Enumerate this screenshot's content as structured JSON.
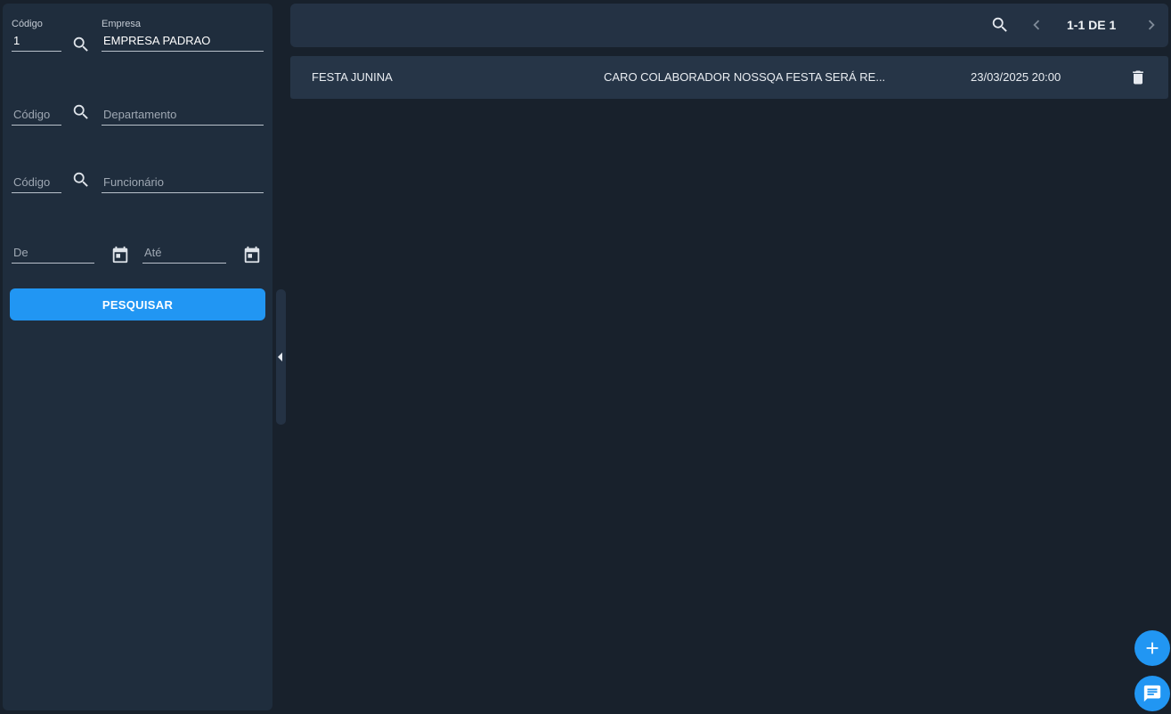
{
  "filters": {
    "empresa_code": {
      "label": "Código",
      "value": "1",
      "placeholder": ""
    },
    "empresa_name": {
      "label": "Empresa",
      "value": "EMPRESA PADRAO",
      "placeholder": ""
    },
    "departamento_code": {
      "placeholder": "Código"
    },
    "departamento_name": {
      "placeholder": "Departamento"
    },
    "funcionario_code": {
      "placeholder": "Código"
    },
    "funcionario_name": {
      "placeholder": "Funcionário"
    },
    "date_from": {
      "placeholder": "De"
    },
    "date_to": {
      "placeholder": "Até"
    },
    "search_label": "PESQUISAR"
  },
  "toolbar": {
    "page_info": "1-1 DE 1"
  },
  "rows": [
    {
      "title": "FESTA JUNINA",
      "message": "CARO COLABORADOR NOSSQA FESTA SERÁ RE...",
      "datetime": "23/03/2025 20:00"
    }
  ],
  "icons": {
    "search": "search-icon",
    "calendar": "calendar-icon",
    "prev": "chevron-left-icon",
    "next": "chevron-right-icon",
    "delete": "trash-icon",
    "add": "plus-icon",
    "chat": "chat-icon"
  },
  "colors": {
    "background": "#18212c",
    "panel": "#1f2d3d",
    "toolbar": "#243244",
    "row": "#263547",
    "accent": "#2196f3"
  }
}
